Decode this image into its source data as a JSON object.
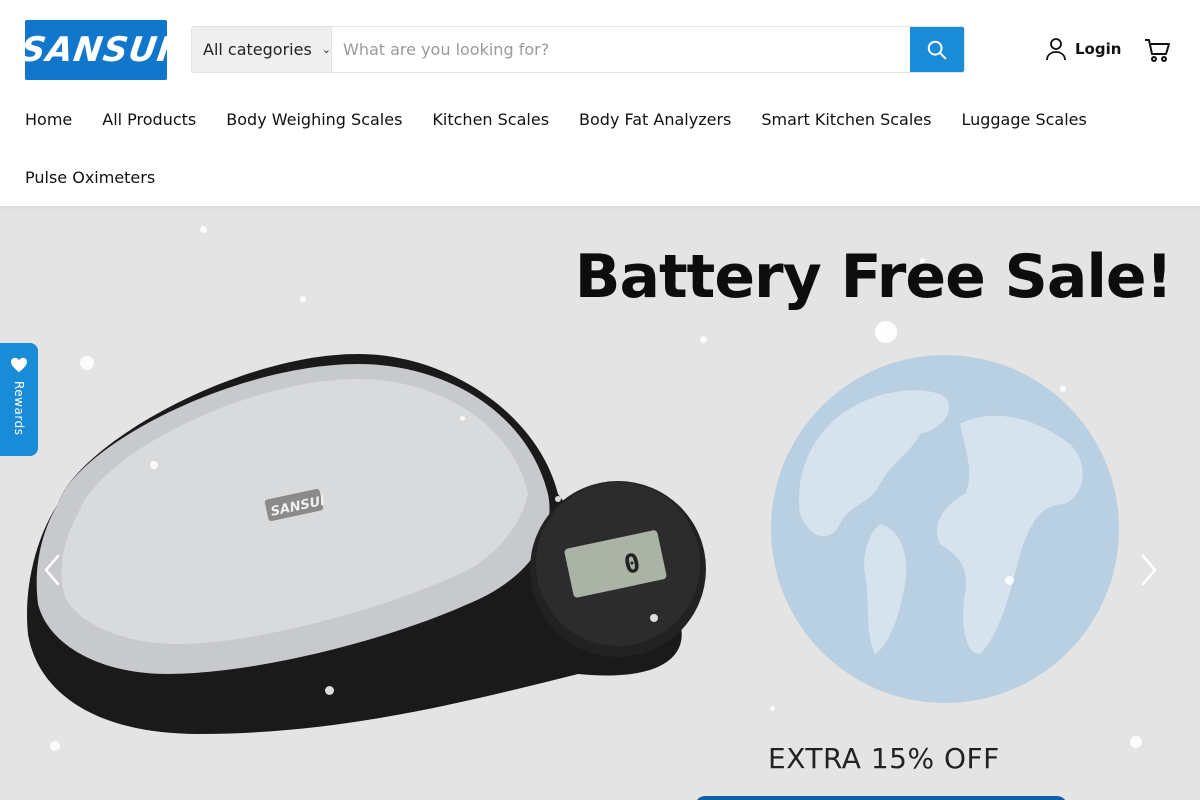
{
  "brand": {
    "logo_text": "SANSUI",
    "accent": "#1a8bd6",
    "logo_bg": "#1177cc"
  },
  "search": {
    "category_label": "All categories",
    "placeholder": "What are you looking for?",
    "button_icon": "search-icon"
  },
  "account": {
    "login_label": "Login",
    "login_icon": "user-icon",
    "cart_icon": "cart-icon"
  },
  "nav": {
    "items": [
      "Home",
      "All Products",
      "Body Weighing Scales",
      "Kitchen Scales",
      "Body Fat Analyzers",
      "Smart Kitchen Scales",
      "Luggage Scales",
      "Pulse Oximeters"
    ]
  },
  "hero": {
    "title": "Battery Free Sale!",
    "offer": "EXTRA 15% OFF",
    "background": "#e4e4e4",
    "product_logo": "SANSUI"
  },
  "rewards": {
    "label": "Rewards",
    "icon": "heart-icon"
  }
}
